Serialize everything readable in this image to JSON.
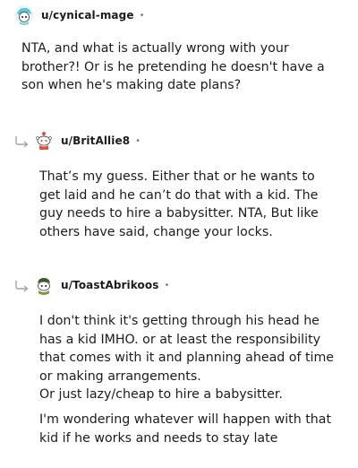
{
  "comments": [
    {
      "username": "u/cynical-mage",
      "separator": "•",
      "avatar_icon": "snoo-avatar-teal-icon",
      "body": [
        "NTA, and what is actually wrong with your brother?! Or is he pretending he doesn't have a son when he's making date plans?"
      ]
    },
    {
      "username": "u/BritAllie8",
      "separator": "•",
      "avatar_icon": "snoo-avatar-red-icon",
      "reply_icon": "reply-arrow-icon",
      "body": [
        "That’s my guess. Either that or he wants to get laid and he can’t do that with a kid. The guy needs to hire a babysitter. NTA, But like others have said, change your locks."
      ]
    },
    {
      "username": "u/ToastAbrikoos",
      "separator": "•",
      "avatar_icon": "snoo-avatar-green-icon",
      "reply_icon": "reply-arrow-icon",
      "body": [
        "I don't think it's getting through his head he has a kid IMHO. or at least the responsibility that comes with it and planning ahead of time or making arrangements.\nOr just lazy/cheap to hire a babysitter.",
        "I'm wondering whatever will happen with that kid if he works and needs to stay late"
      ]
    }
  ],
  "colors": {
    "text": "#1c1c1c",
    "meta": "#7c7c7c",
    "reply_arrow": "#a5a4a4"
  }
}
